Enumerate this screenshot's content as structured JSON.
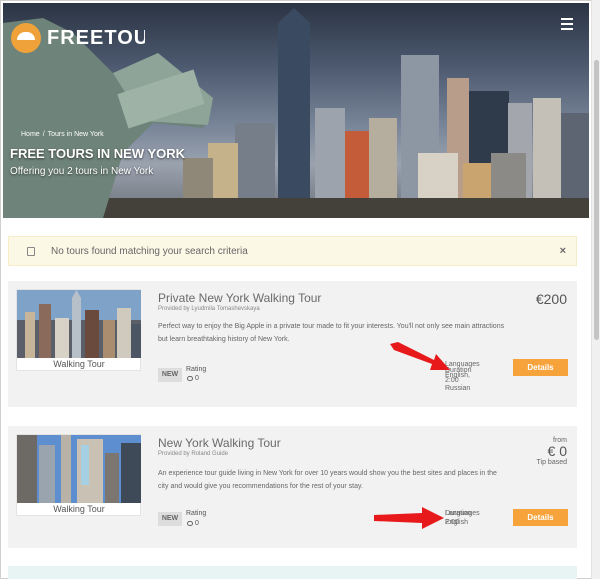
{
  "header": {
    "logo_text": "FREETOURS",
    "menu_icon": "hamburger-icon",
    "breadcrumb": [
      "Home",
      "Tours in New York"
    ],
    "breadcrumb_separator": "/",
    "title": "FREE TOURS IN NEW YORK",
    "subtitle": "Offering you 2 tours in New York"
  },
  "alert": {
    "icon": "info-icon",
    "message": "No tours found matching your search criteria",
    "close_label": "×"
  },
  "tours": [
    {
      "title": "Private New York Walking Tour",
      "provider": "Provided by Lyudmila Tomashevskaya",
      "description": "Perfect way to enjoy the Big Apple in a private tour made to fit your interests. You'll not only see main attractions but learn breathtaking history of New York.",
      "category": "Walking Tour",
      "badge": "NEW",
      "rating_label": "Rating",
      "reviews_count": "0",
      "meta_lines": [
        "Languages",
        "Duration",
        "English,",
        "2:00",
        "Russian"
      ],
      "price": "€200",
      "details_label": "Details"
    },
    {
      "title": "New York Walking Tour",
      "provider": "Provided by Roland Guide",
      "description": "An experience tour guide living in New York for over 10 years would show you the best sites and places in the city and would give you recommendations for the rest of your stay.",
      "category": "Walking Tour",
      "badge": "NEW",
      "rating_label": "Rating",
      "reviews_count": "0",
      "meta_lines": [
        "Languages",
        "Duration",
        "English",
        "2:00"
      ],
      "price_prefix": "from",
      "price": "€ 0",
      "price_note": "Tip based",
      "details_label": "Details"
    }
  ],
  "colors": {
    "accent": "#f6a33b",
    "alert_bg": "#fcf8e6",
    "card_bg": "#f2f2f2",
    "arrow": "#e8191b"
  }
}
